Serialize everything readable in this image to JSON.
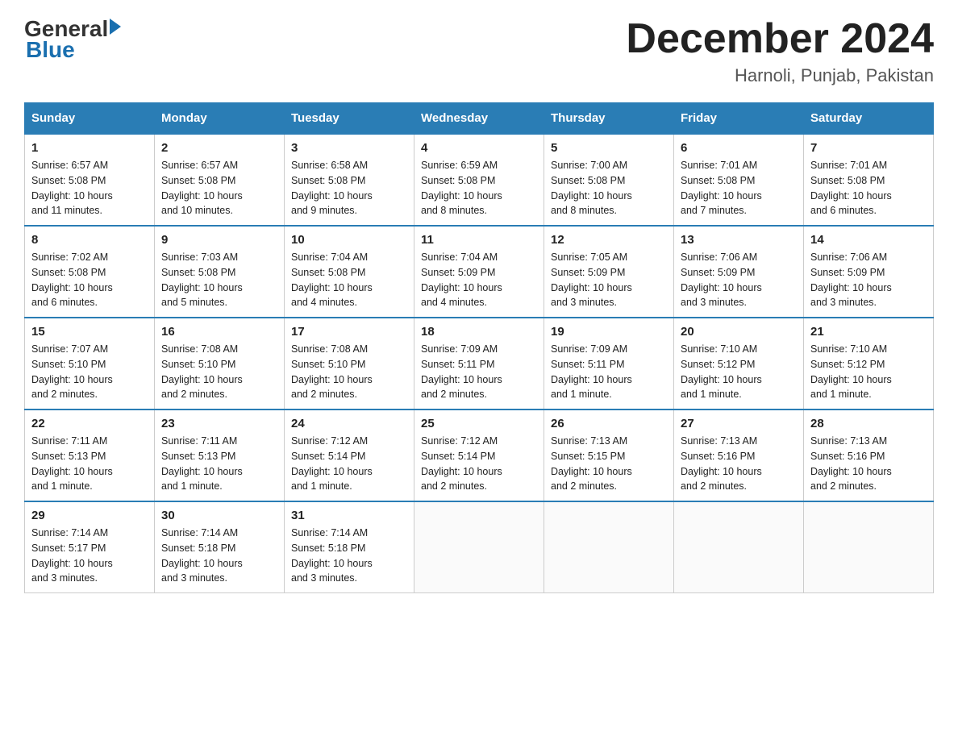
{
  "header": {
    "title": "December 2024",
    "subtitle": "Harnoli, Punjab, Pakistan",
    "logo_general": "General",
    "logo_blue": "Blue"
  },
  "days_of_week": [
    "Sunday",
    "Monday",
    "Tuesday",
    "Wednesday",
    "Thursday",
    "Friday",
    "Saturday"
  ],
  "weeks": [
    [
      {
        "day": "1",
        "sunrise": "6:57 AM",
        "sunset": "5:08 PM",
        "daylight": "10 hours and 11 minutes."
      },
      {
        "day": "2",
        "sunrise": "6:57 AM",
        "sunset": "5:08 PM",
        "daylight": "10 hours and 10 minutes."
      },
      {
        "day": "3",
        "sunrise": "6:58 AM",
        "sunset": "5:08 PM",
        "daylight": "10 hours and 9 minutes."
      },
      {
        "day": "4",
        "sunrise": "6:59 AM",
        "sunset": "5:08 PM",
        "daylight": "10 hours and 8 minutes."
      },
      {
        "day": "5",
        "sunrise": "7:00 AM",
        "sunset": "5:08 PM",
        "daylight": "10 hours and 8 minutes."
      },
      {
        "day": "6",
        "sunrise": "7:01 AM",
        "sunset": "5:08 PM",
        "daylight": "10 hours and 7 minutes."
      },
      {
        "day": "7",
        "sunrise": "7:01 AM",
        "sunset": "5:08 PM",
        "daylight": "10 hours and 6 minutes."
      }
    ],
    [
      {
        "day": "8",
        "sunrise": "7:02 AM",
        "sunset": "5:08 PM",
        "daylight": "10 hours and 6 minutes."
      },
      {
        "day": "9",
        "sunrise": "7:03 AM",
        "sunset": "5:08 PM",
        "daylight": "10 hours and 5 minutes."
      },
      {
        "day": "10",
        "sunrise": "7:04 AM",
        "sunset": "5:08 PM",
        "daylight": "10 hours and 4 minutes."
      },
      {
        "day": "11",
        "sunrise": "7:04 AM",
        "sunset": "5:09 PM",
        "daylight": "10 hours and 4 minutes."
      },
      {
        "day": "12",
        "sunrise": "7:05 AM",
        "sunset": "5:09 PM",
        "daylight": "10 hours and 3 minutes."
      },
      {
        "day": "13",
        "sunrise": "7:06 AM",
        "sunset": "5:09 PM",
        "daylight": "10 hours and 3 minutes."
      },
      {
        "day": "14",
        "sunrise": "7:06 AM",
        "sunset": "5:09 PM",
        "daylight": "10 hours and 3 minutes."
      }
    ],
    [
      {
        "day": "15",
        "sunrise": "7:07 AM",
        "sunset": "5:10 PM",
        "daylight": "10 hours and 2 minutes."
      },
      {
        "day": "16",
        "sunrise": "7:08 AM",
        "sunset": "5:10 PM",
        "daylight": "10 hours and 2 minutes."
      },
      {
        "day": "17",
        "sunrise": "7:08 AM",
        "sunset": "5:10 PM",
        "daylight": "10 hours and 2 minutes."
      },
      {
        "day": "18",
        "sunrise": "7:09 AM",
        "sunset": "5:11 PM",
        "daylight": "10 hours and 2 minutes."
      },
      {
        "day": "19",
        "sunrise": "7:09 AM",
        "sunset": "5:11 PM",
        "daylight": "10 hours and 1 minute."
      },
      {
        "day": "20",
        "sunrise": "7:10 AM",
        "sunset": "5:12 PM",
        "daylight": "10 hours and 1 minute."
      },
      {
        "day": "21",
        "sunrise": "7:10 AM",
        "sunset": "5:12 PM",
        "daylight": "10 hours and 1 minute."
      }
    ],
    [
      {
        "day": "22",
        "sunrise": "7:11 AM",
        "sunset": "5:13 PM",
        "daylight": "10 hours and 1 minute."
      },
      {
        "day": "23",
        "sunrise": "7:11 AM",
        "sunset": "5:13 PM",
        "daylight": "10 hours and 1 minute."
      },
      {
        "day": "24",
        "sunrise": "7:12 AM",
        "sunset": "5:14 PM",
        "daylight": "10 hours and 1 minute."
      },
      {
        "day": "25",
        "sunrise": "7:12 AM",
        "sunset": "5:14 PM",
        "daylight": "10 hours and 2 minutes."
      },
      {
        "day": "26",
        "sunrise": "7:13 AM",
        "sunset": "5:15 PM",
        "daylight": "10 hours and 2 minutes."
      },
      {
        "day": "27",
        "sunrise": "7:13 AM",
        "sunset": "5:16 PM",
        "daylight": "10 hours and 2 minutes."
      },
      {
        "day": "28",
        "sunrise": "7:13 AM",
        "sunset": "5:16 PM",
        "daylight": "10 hours and 2 minutes."
      }
    ],
    [
      {
        "day": "29",
        "sunrise": "7:14 AM",
        "sunset": "5:17 PM",
        "daylight": "10 hours and 3 minutes."
      },
      {
        "day": "30",
        "sunrise": "7:14 AM",
        "sunset": "5:18 PM",
        "daylight": "10 hours and 3 minutes."
      },
      {
        "day": "31",
        "sunrise": "7:14 AM",
        "sunset": "5:18 PM",
        "daylight": "10 hours and 3 minutes."
      },
      null,
      null,
      null,
      null
    ]
  ],
  "labels": {
    "sunrise": "Sunrise:",
    "sunset": "Sunset:",
    "daylight": "Daylight:"
  }
}
